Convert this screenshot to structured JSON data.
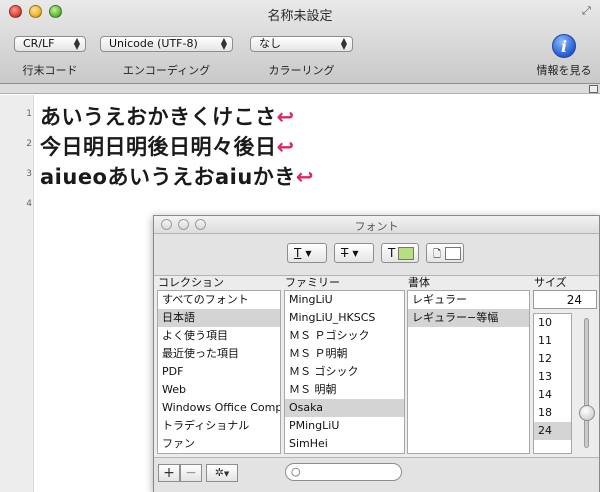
{
  "window": {
    "title": "名称未設定",
    "toolbar": {
      "line_ending": {
        "value": "CR/LF",
        "label": "行末コード"
      },
      "encoding": {
        "value": "Unicode (UTF-8)",
        "label": "エンコーディング"
      },
      "coloring": {
        "value": "なし",
        "label": "カラーリング"
      },
      "info": {
        "glyph": "i",
        "label": "情報を見る"
      }
    }
  },
  "editor": {
    "line_numbers": [
      "1",
      "2",
      "3",
      "4"
    ],
    "lines": [
      "あいうえおかきくけこさ",
      "今日明日明後日明々後日",
      "aiueoあいうえおaiuかき"
    ],
    "return_glyph": "↩",
    "return_color": "#e0246a"
  },
  "font_panel": {
    "title": "フォント",
    "toolbar": {
      "underline": "T",
      "strike": "T",
      "text_color_label": "T",
      "text_color": "#b6e07a",
      "doc_color": "#ffffff"
    },
    "columns": {
      "collection": "コレクション",
      "family": "ファミリー",
      "typeface": "書体",
      "size": "サイズ"
    },
    "collections": [
      "すべてのフォント",
      "日本語",
      "よく使う項目",
      "最近使った項目",
      "PDF",
      "Web",
      "Windows Office Comp",
      "トラディショナル",
      "ファン"
    ],
    "collection_selected": 1,
    "families": [
      "MingLiU",
      "MingLiU_HKSCS",
      "ＭＳ Ｐゴシック",
      "ＭＳ Ｐ明朝",
      "ＭＳ ゴシック",
      "ＭＳ 明朝",
      "Osaka",
      "PMingLiU",
      "SimHei"
    ],
    "family_selected": 6,
    "typefaces": [
      "レギュラー",
      "レギュラー−等幅"
    ],
    "typeface_selected": 1,
    "size_value": "24",
    "sizes": [
      "10",
      "11",
      "12",
      "13",
      "14",
      "18",
      "24"
    ],
    "size_selected": 6,
    "bottom": {
      "add": "+",
      "remove": "−",
      "action": "✲"
    }
  }
}
